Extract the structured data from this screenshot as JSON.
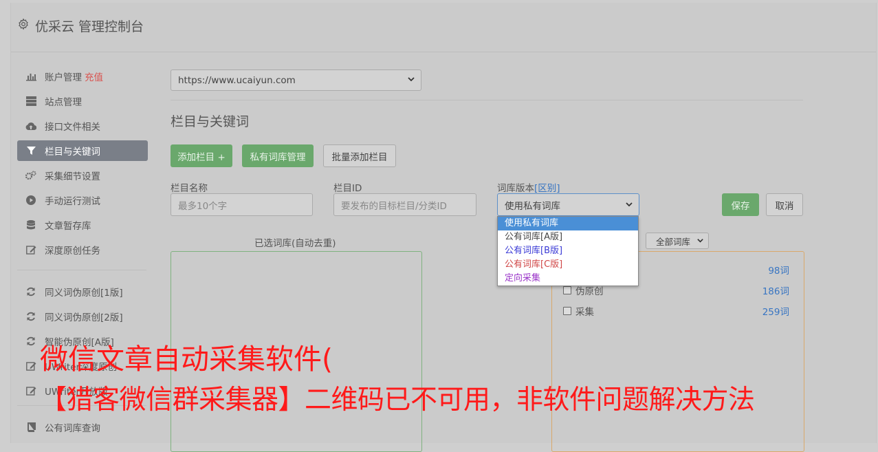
{
  "app": {
    "title": "优采云 管理控制台"
  },
  "sidebar": {
    "items": [
      {
        "label": "账户管理",
        "extra": "充值",
        "icon": "bar-chart-icon"
      },
      {
        "label": "站点管理",
        "icon": "server-icon"
      },
      {
        "label": "接口文件相关",
        "icon": "cloud-upload-icon"
      },
      {
        "label": "栏目与关键词",
        "icon": "filter-icon",
        "active": true
      },
      {
        "label": "采集细节设置",
        "icon": "gears-icon"
      },
      {
        "label": "手动运行测试",
        "icon": "play-circle-icon"
      },
      {
        "label": "文章暂存库",
        "icon": "database-icon"
      },
      {
        "label": "深度原创任务",
        "icon": "edit-icon"
      }
    ],
    "items2": [
      {
        "label": "同义词伪原创[1版]",
        "icon": "refresh-icon"
      },
      {
        "label": "同义词伪原创[2版]",
        "icon": "refresh-icon"
      },
      {
        "label": "智能伪原创[A版]",
        "icon": "refresh-icon"
      },
      {
        "label": "UWriter深度原创",
        "icon": "edit-icon"
      },
      {
        "label": "UWriter开放版",
        "icon": "edit-icon"
      }
    ],
    "items3": [
      {
        "label": "公有词库查询",
        "icon": "book-icon"
      }
    ]
  },
  "main": {
    "site_select": "https://www.ucaiyun.com",
    "section_title": "栏目与关键词",
    "buttons": {
      "add_column": "添加栏目 +",
      "private_lib": "私有词库管理",
      "batch_add": "批量添加栏目"
    },
    "form": {
      "name_label": "栏目名称",
      "name_placeholder": "最多10个字",
      "id_label": "栏目ID",
      "id_placeholder": "要发布的目标栏目/分类ID",
      "lib_label": "词库版本",
      "lib_label_link": "[区别]",
      "lib_value": "使用私有词库",
      "save": "保存",
      "cancel": "取消"
    },
    "dropdown_options": [
      "使用私有词库",
      "公有词库[A版]",
      "公有词库[B版]",
      "公有词库[C版]",
      "定向采集"
    ],
    "selected_panel_title": "已选词库(自动去重)",
    "all_libs_select": "全部词库",
    "lib_rows": [
      {
        "label": "",
        "count": "98词"
      },
      {
        "label": "伪原创",
        "count": "186词"
      },
      {
        "label": "采集",
        "count": "259词"
      }
    ]
  },
  "overlay": {
    "line1": "微信文章自动采集软件(",
    "line2": "【猎客微信群采集器】二维码已不可用，非软件问题解决方法"
  },
  "colors": {
    "green_button": "#6aa86c",
    "active_sidebar": "#7a7f88",
    "recharge": "#d9534f",
    "link_blue": "#3875c2",
    "overlay_red": "#ff1a1a",
    "dd_a": "#444444",
    "dd_b": "#3a3ad6",
    "dd_c": "#d04646",
    "dd_directed": "#9a35c9"
  }
}
